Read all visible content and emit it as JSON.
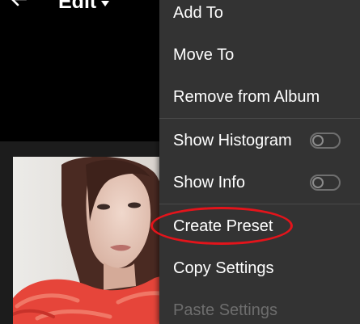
{
  "header": {
    "title": "Edit",
    "back_icon": "arrow-left-icon",
    "title_dropdown_icon": "caret-down-icon"
  },
  "menu": {
    "items": [
      {
        "label": "Add To",
        "enabled": true
      },
      {
        "label": "Move To",
        "enabled": true
      },
      {
        "label": "Remove from Album",
        "enabled": true
      },
      {
        "label": "Show Histogram",
        "enabled": true,
        "toggle": false
      },
      {
        "label": "Show Info",
        "enabled": true,
        "toggle": false
      },
      {
        "label": "Create Preset",
        "enabled": true,
        "highlighted": true
      },
      {
        "label": "Copy Settings",
        "enabled": true
      },
      {
        "label": "Paste Settings",
        "enabled": false
      }
    ]
  },
  "colors": {
    "menu_background": "#333333",
    "highlight_ring": "#e3141b",
    "disabled_text": "#6d6d6d"
  }
}
